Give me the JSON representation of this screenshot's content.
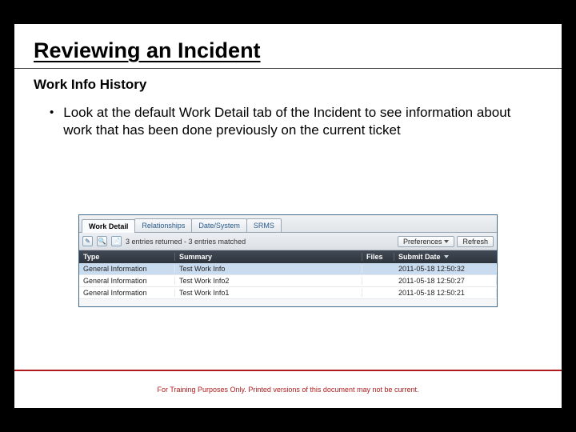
{
  "title": "Reviewing an Incident",
  "subtitle": "Work Info History",
  "bullet": "Look at the default Work Detail tab of the Incident to see information about work that has been done previously on the current ticket",
  "screenshot": {
    "tabs": [
      "Work Detail",
      "Relationships",
      "Date/System",
      "SRMS"
    ],
    "active_tab_index": 0,
    "entries_text": "3 entries returned - 3 entries matched",
    "preferences_btn": "Preferences",
    "refresh_btn": "Refresh",
    "columns": {
      "type": "Type",
      "summary": "Summary",
      "files": "Files",
      "submit_date": "Submit Date"
    },
    "rows": [
      {
        "type": "General Information",
        "summary": "Test Work Info",
        "files": "",
        "date": "2011-05-18 12:50:32"
      },
      {
        "type": "General Information",
        "summary": "Test Work Info2",
        "files": "",
        "date": "2011-05-18 12:50:27"
      },
      {
        "type": "General Information",
        "summary": "Test Work Info1",
        "files": "",
        "date": "2011-05-18 12:50:21"
      }
    ]
  },
  "footer": "For Training Purposes Only. Printed versions of this document may not be current."
}
